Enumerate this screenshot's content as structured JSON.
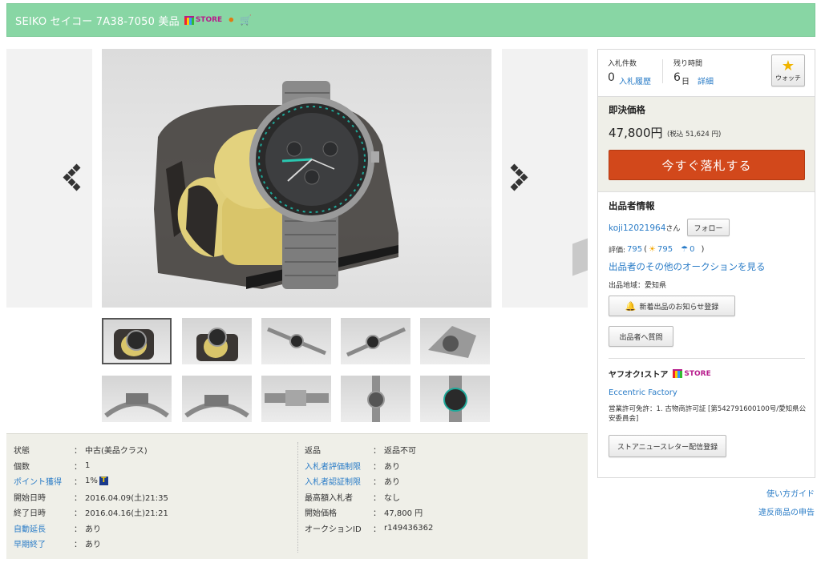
{
  "header": {
    "title": "SEIKO セイコー 7A38-7050 美品",
    "store_label": "STORE"
  },
  "gallery": {
    "thumbnail_count": 10,
    "selected_index": 0
  },
  "details": {
    "left": [
      {
        "key": "状態",
        "value": "中古(美品クラス)",
        "link": false
      },
      {
        "key": "個数",
        "value": "1",
        "link": false
      },
      {
        "key": "ポイント獲得",
        "value": "1%",
        "link": true
      },
      {
        "key": "開始日時",
        "value": "2016.04.09(土)21:35",
        "link": false
      },
      {
        "key": "終了日時",
        "value": "2016.04.16(土)21:21",
        "link": false
      },
      {
        "key": "自動延長",
        "value": "あり",
        "link": true
      },
      {
        "key": "早期終了",
        "value": "あり",
        "link": true
      }
    ],
    "right": [
      {
        "key": "返品",
        "value": "返品不可",
        "link": false
      },
      {
        "key": "入札者評価制限",
        "value": "あり",
        "link": true
      },
      {
        "key": "入札者認証制限",
        "value": "あり",
        "link": true
      },
      {
        "key": "最高額入札者",
        "value": "なし",
        "link": false
      },
      {
        "key": "開始価格",
        "value": "47,800 円",
        "link": false
      },
      {
        "key": "オークションID",
        "value": "r149436362",
        "link": false
      }
    ],
    "colon": "：",
    "tpoint_label": "T"
  },
  "bid": {
    "count_label": "入札件数",
    "count_value": "0",
    "history_link": "入札履歴",
    "time_label": "残り時間",
    "time_value": "6",
    "time_unit": "日",
    "detail_link": "詳細",
    "watch_label": "ウォッチ"
  },
  "buy": {
    "label": "即決価格",
    "price": "47,800円",
    "tax_note": "(税込 51,624 円)",
    "button": "今すぐ落札する"
  },
  "seller": {
    "title": "出品者情報",
    "name": "koji12021964",
    "honorific": "さん",
    "follow": "フォロー",
    "rating_label": "評価:",
    "rating": "795",
    "good": "795",
    "bad": "0",
    "paren_open": "(",
    "paren_close": ")",
    "other_auctions": "出品者のその他のオークションを見る",
    "area": "出品地域：愛知県",
    "notify_button": "新着出品のお知らせ登録",
    "question_button": "出品者へ質問"
  },
  "store": {
    "title": "ヤフオク!ストア",
    "store_label": "STORE",
    "name": "Eccentric Factory",
    "license": "営業許可免許：1. 古物商許可証 [第542791600100号/愛知県公安委員会]",
    "newsletter_button": "ストアニュースレター配信登録"
  },
  "footer": {
    "guide": "使い方ガイド",
    "report": "違反商品の申告"
  },
  "colors": {
    "header_bg": "#88d6a4",
    "buy_button": "#d2481b",
    "link": "#2a7cc7"
  }
}
